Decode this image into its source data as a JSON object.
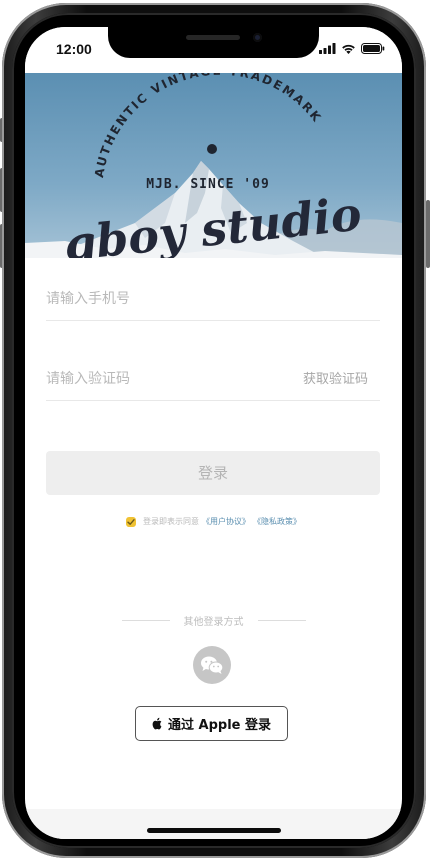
{
  "status_bar": {
    "time": "12:00"
  },
  "hero": {
    "arc_text": "AUTHENTIC VINTAGE TRADEMARK",
    "sub_text": "MJB. SINCE '09",
    "brand": "gboy studio"
  },
  "form": {
    "phone_placeholder": "请输入手机号",
    "code_placeholder": "请输入验证码",
    "get_code_label": "获取验证码",
    "login_label": "登录"
  },
  "agreement": {
    "checked": true,
    "prefix": "登录即表示同意",
    "user_agreement": "《用户协议》",
    "privacy_policy": "《隐私政策》"
  },
  "other_login": {
    "label": "其他登录方式",
    "wechat_icon": "wechat-icon",
    "apple_label": "通过 Apple 登录"
  },
  "colors": {
    "check_accent": "#f0c233",
    "link": "#5b8fb0",
    "login_disabled_bg": "#eeeeee"
  }
}
